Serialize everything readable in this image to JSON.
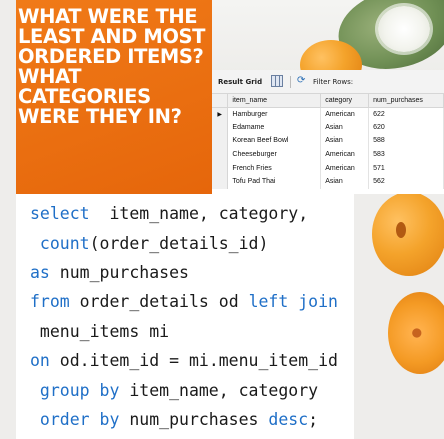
{
  "title_card": {
    "lines": [
      "WHAT WERE THE",
      "LEAST AND MOST",
      "ORDERED ITEMS?",
      "WHAT CATEGORIES",
      "WERE THEY IN?"
    ]
  },
  "result_grid": {
    "label": "Result Grid",
    "filter_label": "Filter Rows:",
    "columns": [
      "item_name",
      "category",
      "num_purchases"
    ],
    "rows": [
      [
        "Hamburger",
        "American",
        "622"
      ],
      [
        "Edamame",
        "Asian",
        "620"
      ],
      [
        "Korean Beef Bowl",
        "Asian",
        "588"
      ],
      [
        "Cheeseburger",
        "American",
        "583"
      ],
      [
        "French Fries",
        "American",
        "571"
      ],
      [
        "Tofu Pad Thai",
        "Asian",
        "562"
      ]
    ],
    "current_row_marker": "▶"
  },
  "sql": {
    "line1": {
      "kw": "select",
      "rest": "  item_name, category,"
    },
    "line2": {
      "kw": " count",
      "rest": "(order_details_id)"
    },
    "line3": {
      "kw": "as",
      "rest": " num_purchases"
    },
    "line4": {
      "kw": "from",
      "rest": " order_details od ",
      "kw2": "left join"
    },
    "line5": {
      "rest": " menu_items mi"
    },
    "line6": {
      "kw": "on",
      "rest": " od.item_id = mi.menu_item_id"
    },
    "line7": {
      "kw": " group by",
      "rest": " item_name, category"
    },
    "line8": {
      "kw": " order by",
      "rest": " num_purchases ",
      "kw2": "desc",
      "rest2": ";"
    }
  },
  "colors": {
    "title_card": "#e96d0f",
    "keyword": "#1f6fc7",
    "code_text": "#1a1a1a"
  }
}
